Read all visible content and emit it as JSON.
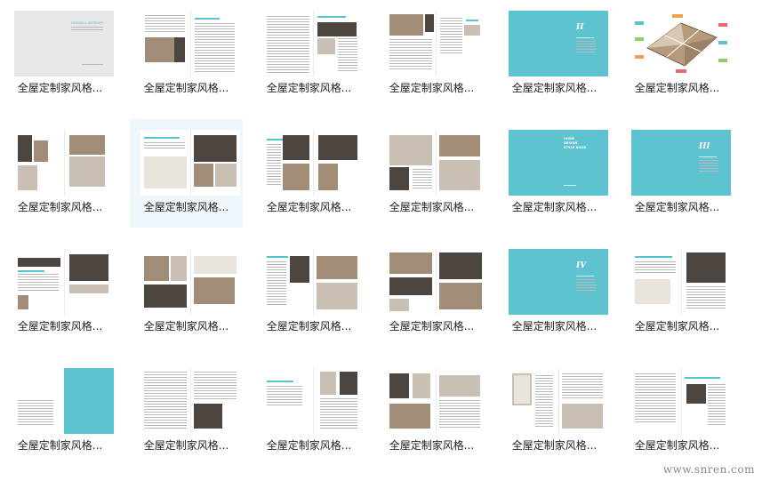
{
  "items": [
    {
      "caption": "全屋定制家风格...",
      "kind": "grey",
      "subtitle": "DESIGN & INTERIOR"
    },
    {
      "caption": "全屋定制家风格...",
      "kind": "spreadA"
    },
    {
      "caption": "全屋定制家风格...",
      "kind": "spreadB"
    },
    {
      "caption": "全屋定制家风格...",
      "kind": "spreadC"
    },
    {
      "caption": "全屋定制家风格...",
      "kind": "cover",
      "numeral": "II"
    },
    {
      "caption": "全屋定制家风格...",
      "kind": "floorplan"
    },
    {
      "caption": "全屋定制家风格...",
      "kind": "spreadD"
    },
    {
      "caption": "全屋定制家风格...",
      "kind": "spreadE",
      "selected": true
    },
    {
      "caption": "全屋定制家风格...",
      "kind": "spreadF"
    },
    {
      "caption": "全屋定制家风格...",
      "kind": "spreadG"
    },
    {
      "caption": "全屋定制家风格...",
      "kind": "coverTitle",
      "lines": [
        "HOME",
        "DESIGN",
        "STYLE BOOK"
      ]
    },
    {
      "caption": "全屋定制家风格...",
      "kind": "cover",
      "numeral": "III"
    },
    {
      "caption": "全屋定制家风格...",
      "kind": "spreadH"
    },
    {
      "caption": "全屋定制家风格...",
      "kind": "spreadI"
    },
    {
      "caption": "全屋定制家风格...",
      "kind": "spreadJ"
    },
    {
      "caption": "全屋定制家风格...",
      "kind": "spreadK"
    },
    {
      "caption": "全屋定制家风格...",
      "kind": "cover",
      "numeral": "IV"
    },
    {
      "caption": "全屋定制家风格...",
      "kind": "spreadL"
    },
    {
      "caption": "全屋定制家风格...",
      "kind": "halfCover"
    },
    {
      "caption": "全屋定制家风格...",
      "kind": "textSpread"
    },
    {
      "caption": "全屋定制家风格...",
      "kind": "drawingA"
    },
    {
      "caption": "全屋定制家风格...",
      "kind": "drawingB"
    },
    {
      "caption": "全屋定制家风格...",
      "kind": "wardrobe"
    },
    {
      "caption": "全屋定制家风格...",
      "kind": "drawingC"
    }
  ],
  "watermark": "www.snren.com",
  "colors": {
    "accent": "#5ec3d0",
    "selected_bg": "#f0f7fc",
    "caption": "#222222"
  }
}
